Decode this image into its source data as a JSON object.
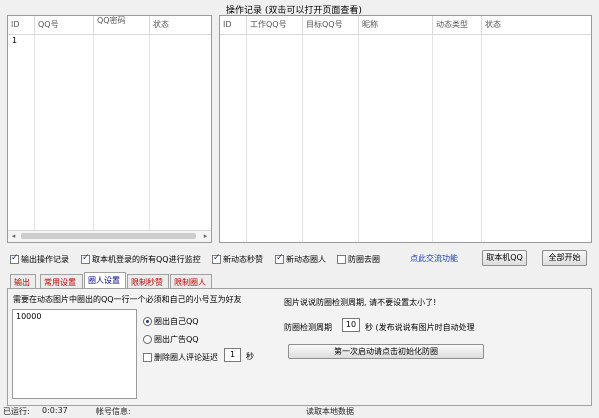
{
  "left_panel": {
    "title": "",
    "columns": [
      "ID",
      "QQ号",
      "QQ密码",
      "状态"
    ],
    "rows": [
      [
        "1",
        "",
        "",
        ""
      ]
    ]
  },
  "right_panel": {
    "title": "操作记录 (双击可以打开页面查看)",
    "columns": [
      "ID",
      "工作QQ号",
      "目标QQ号",
      "昵称",
      "动态类型",
      "状态"
    ]
  },
  "scrollbar": {
    "left": "◂",
    "right": "▸"
  },
  "options": {
    "log_ops": "输出操作记录",
    "monitor_all": "取本机登录的所有QQ进行监控",
    "new_like": "新动态秒赞",
    "new_circle": "新动态圈人",
    "anti_circle": "防圈去圈",
    "exchange_link": "点此交流功能",
    "get_qq_button": "取本机QQ",
    "start_all_button": "全部开始"
  },
  "tabs": [
    "输出",
    "常用设置",
    "圈人设置",
    "限制秒赞",
    "限制圈人"
  ],
  "active_tab": 2,
  "circle": {
    "instruction": "需要在动态图片中圈出的QQ一行一个必须和自己的小号互为好友",
    "qq_list": "10000",
    "radio_self": "圈出自己QQ",
    "radio_ad": "圈出广告QQ",
    "delete_label": "删除圈人评论延迟",
    "delete_value": "1",
    "delete_unit": "秒",
    "anti_title": "图片说说防圈检测周期, 请不要设置太小了!",
    "period_label": "防圈检测周期",
    "period_value": "10",
    "period_suffix": "秒 (发布说说有图片时自动处理",
    "init_button": "第一次启动请点击初始化防圈"
  },
  "status": {
    "runtime_label": "已运行:",
    "runtime_value": "0:0:37",
    "account_label": "帐号信息:",
    "reading_label": "读取本地数据"
  },
  "colors": {
    "tab_red": "#c00000",
    "active_tab": "#00008b",
    "link_blue": "#1a3cc0"
  }
}
